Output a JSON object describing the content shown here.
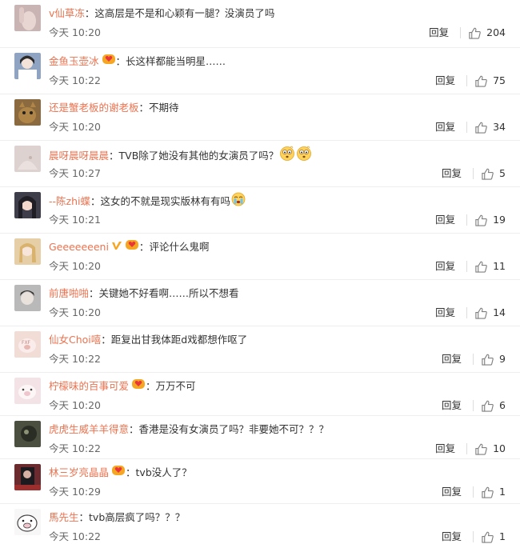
{
  "comments": [
    {
      "user": "v仙草冻",
      "text": "这高层是不是和心颖有一腿？没演员了吗",
      "time": "今天 10:20",
      "reply": "回复",
      "likes": "204",
      "avatar": "hand",
      "avatarColor": "#c9b3b3"
    },
    {
      "user": "金鱼玉壶冰",
      "text": "长这样都能当明星……",
      "time": "今天 10:22",
      "reply": "回复",
      "likes": "75",
      "avatar": "girl",
      "avatarColor": "#8fa3c2",
      "badge": "vip-icon"
    },
    {
      "user": "还是蟹老板的谢老板",
      "text": "不期待",
      "time": "今天 10:20",
      "reply": "回复",
      "likes": "34",
      "avatar": "cat",
      "avatarColor": "#8a6a3e"
    },
    {
      "user": "晨呀晨呀晨晨",
      "text": "TVB除了她没有其他的女演员了吗？",
      "time": "今天 10:27",
      "reply": "回复",
      "likes": "5",
      "avatar": "pale",
      "avatarColor": "#ddd2cf",
      "emojis": [
        "confused-face-icon",
        "confused-face-icon"
      ]
    },
    {
      "user": "--陈zhi蝶",
      "text": "这女的不就是现实版林有有吗",
      "time": "今天 10:21",
      "reply": "回复",
      "likes": "19",
      "avatar": "girl2",
      "avatarColor": "#3e3e4a",
      "emojis": [
        "crying-face-icon"
      ]
    },
    {
      "user": "Geeeeeeeni",
      "text": "评论什么鬼啊",
      "time": "今天 10:20",
      "reply": "回复",
      "likes": "11",
      "avatar": "blonde",
      "avatarColor": "#e6cfa6",
      "badge": "vip-icon",
      "verified": true
    },
    {
      "user": "前唐啪啪",
      "text": "关键她不好看啊……所以不想看",
      "time": "今天 10:20",
      "reply": "回复",
      "likes": "14",
      "avatar": "guy",
      "avatarColor": "#b9b9b9"
    },
    {
      "user": "仙女Choi嘻",
      "text": "距复出甘我体距d戏都想作呕了",
      "time": "今天 10:22",
      "reply": "回复",
      "likes": "9",
      "avatar": "pig",
      "avatarColor": "#f1dcd6"
    },
    {
      "user": "柠檬味的百事可爱",
      "text": "万万不可",
      "time": "今天 10:20",
      "reply": "回复",
      "likes": "6",
      "avatar": "pig2",
      "avatarColor": "#f3e3e6",
      "badge": "vip-icon"
    },
    {
      "user": "虎虎生威羊羊得意",
      "text": "香港是没有女演员了吗？非要她不可？？？",
      "time": "今天 10:22",
      "reply": "回复",
      "likes": "10",
      "avatar": "dark",
      "avatarColor": "#4b4f3f"
    },
    {
      "user": "林三岁亮晶晶",
      "text": "tvb没人了？",
      "time": "今天 10:29",
      "reply": "回复",
      "likes": "1",
      "avatar": "red",
      "avatarColor": "#6a2a2e",
      "badge": "vip-icon"
    },
    {
      "user": "馬先生",
      "text": "tvb高层疯了吗？？？",
      "time": "今天 10:22",
      "reply": "回复",
      "likes": "1",
      "avatar": "pig3",
      "avatarColor": "#f7f7f7"
    }
  ],
  "colors": {
    "username": "#eb7350",
    "text": "#333333",
    "time": "#666666",
    "divider": "#eeeeee"
  }
}
